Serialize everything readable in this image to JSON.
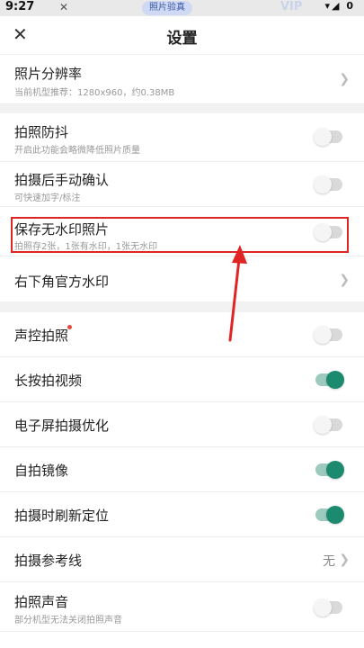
{
  "status_bar": {
    "time": "9:27",
    "pill_text": "照片验真",
    "vip": "VIP",
    "system": "▾◢ 0"
  },
  "header": {
    "title": "设置",
    "close_icon": "close-icon"
  },
  "settings": [
    {
      "title": "照片分辨率",
      "subtitle": "当前机型推荐：1280x960，约0.38MB",
      "control": "chevron"
    },
    {
      "title": "拍照防抖",
      "subtitle": "开启此功能会略微降低照片质量",
      "control": "toggle",
      "on": false
    },
    {
      "title": "拍摄后手动确认",
      "subtitle": "可快速加字/标注",
      "control": "toggle",
      "on": false
    },
    {
      "title": "保存无水印照片",
      "subtitle": "拍照存2张，1张有水印，1张无水印",
      "control": "toggle",
      "on": false
    },
    {
      "title": "右下角官方水印",
      "control": "chevron"
    },
    {
      "title": "声控拍照",
      "control": "toggle",
      "on": false
    },
    {
      "title": "长按拍视频",
      "control": "toggle",
      "on": true
    },
    {
      "title": "电子屏拍摄优化",
      "control": "toggle",
      "on": false
    },
    {
      "title": "自拍镜像",
      "control": "toggle",
      "on": true
    },
    {
      "title": "拍摄时刷新定位",
      "control": "toggle",
      "on": true
    },
    {
      "title": "拍摄参考线",
      "value": "无",
      "control": "chevron"
    },
    {
      "title": "拍照声音",
      "subtitle": "部分机型无法关闭拍照声音",
      "control": "toggle",
      "on": false
    }
  ],
  "colors": {
    "accent": "#1b8a6e",
    "highlight": "#e02424",
    "badge": "#e64b3b"
  }
}
